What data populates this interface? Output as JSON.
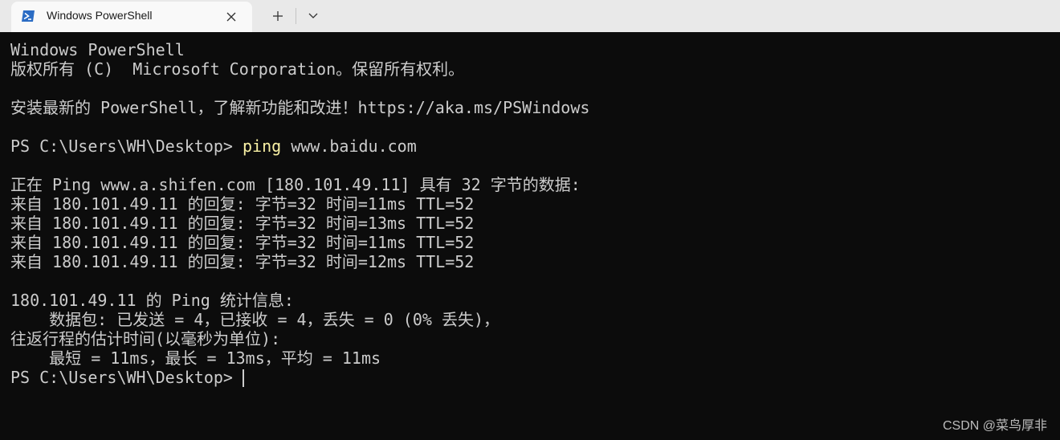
{
  "tab": {
    "title": "Windows PowerShell",
    "icon": "powershell-icon"
  },
  "terminal": {
    "lines": [
      "Windows PowerShell",
      "版权所有 (C)  Microsoft Corporation。保留所有权利。",
      "",
      "安装最新的 PowerShell，了解新功能和改进！https://aka.ms/PSWindows",
      "",
      "PS C:\\Users\\WH\\Desktop> ",
      "",
      "正在 Ping www.a.shifen.com [180.101.49.11] 具有 32 字节的数据:",
      "来自 180.101.49.11 的回复: 字节=32 时间=11ms TTL=52",
      "来自 180.101.49.11 的回复: 字节=32 时间=13ms TTL=52",
      "来自 180.101.49.11 的回复: 字节=32 时间=11ms TTL=52",
      "来自 180.101.49.11 的回复: 字节=32 时间=12ms TTL=52",
      "",
      "180.101.49.11 的 Ping 统计信息:",
      "    数据包: 已发送 = 4，已接收 = 4，丢失 = 0 (0% 丢失)，",
      "往返行程的估计时间(以毫秒为单位):",
      "    最短 = 11ms，最长 = 13ms，平均 = 11ms",
      "PS C:\\Users\\WH\\Desktop> "
    ],
    "command": "ping",
    "command_args": " www.baidu.com",
    "colors": {
      "background": "#0c0c0c",
      "text": "#cccccc",
      "command": "#f9f1a5"
    }
  },
  "watermark": "CSDN @菜鸟厚非"
}
